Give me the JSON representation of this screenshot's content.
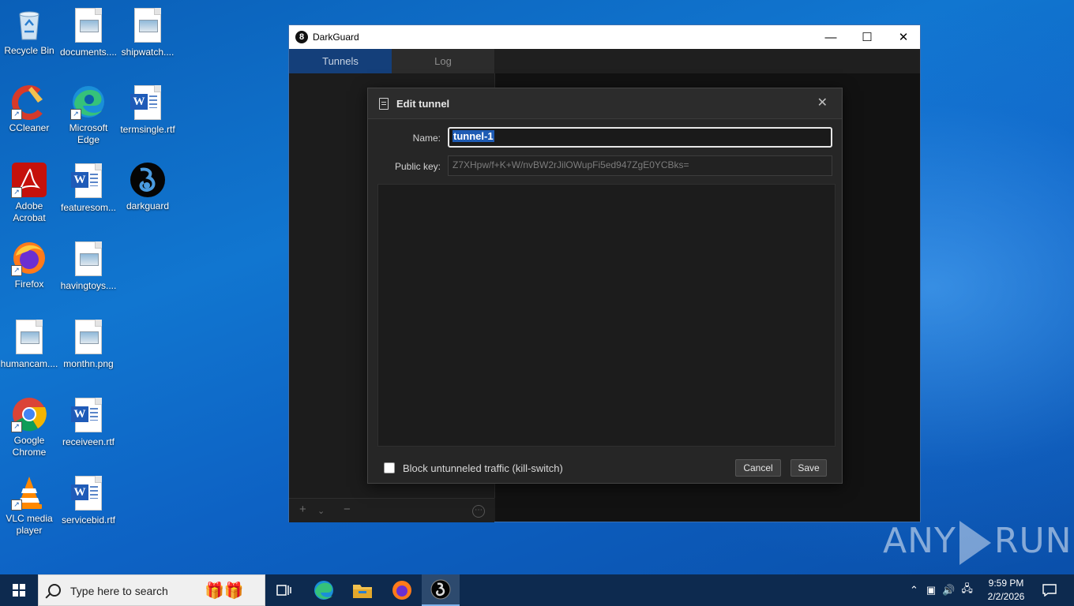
{
  "desktop": {
    "icons": [
      {
        "label": "Recycle Bin"
      },
      {
        "label": "documents...."
      },
      {
        "label": "shipwatch...."
      },
      {
        "label": "CCleaner"
      },
      {
        "label": "Microsoft Edge"
      },
      {
        "label": "termsingle.rtf"
      },
      {
        "label": "Adobe Acrobat"
      },
      {
        "label": "featuresom..."
      },
      {
        "label": "darkguard"
      },
      {
        "label": "Firefox"
      },
      {
        "label": "havingtoys...."
      },
      {
        "label": "humancam...."
      },
      {
        "label": "monthn.png"
      },
      {
        "label": "Google Chrome"
      },
      {
        "label": "receiveen.rtf"
      },
      {
        "label": "VLC media player"
      },
      {
        "label": "servicebid.rtf"
      }
    ]
  },
  "window": {
    "title": "DarkGuard",
    "tabs": [
      {
        "label": "Tunnels",
        "active": true
      },
      {
        "label": "Log",
        "active": false
      }
    ],
    "bottombar": {
      "add": "+",
      "dropdown": "⌄",
      "remove": "−",
      "more": "⋯"
    }
  },
  "dialog": {
    "title": "Edit tunnel",
    "name_label": "Name:",
    "name_value": "tunnel-1",
    "public_key_label": "Public key:",
    "public_key_value": "Z7XHpw/f+K+W/nvBW2rJilOWupFi5ed947ZgE0YCBks=",
    "killswitch_label": "Block untunneled traffic (kill-switch)",
    "killswitch_checked": false,
    "cancel_label": "Cancel",
    "save_label": "Save"
  },
  "watermark": {
    "left": "ANY",
    "right": "RUN"
  },
  "taskbar": {
    "search_placeholder": "Type here to search",
    "clock_time": "9:59 PM",
    "clock_date": "2/2/2026"
  },
  "colors": {
    "accent_tab": "#143f7a",
    "taskbar": "#0d2a4f",
    "selection": "#1e5bb4"
  }
}
